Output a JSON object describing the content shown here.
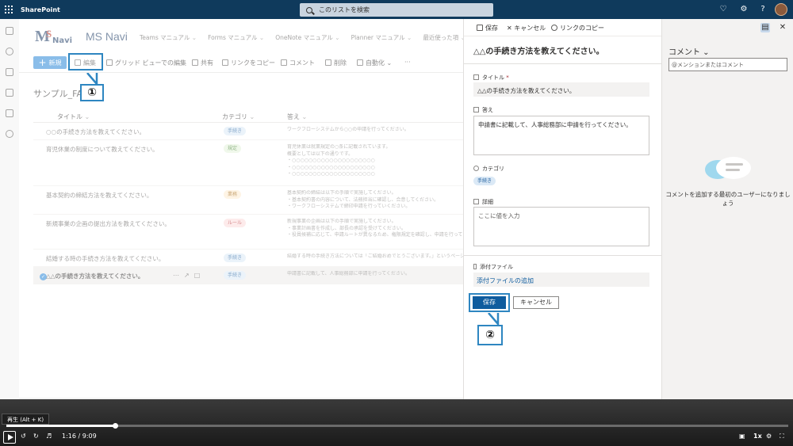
{
  "suitebar": {
    "brand": "SharePoint",
    "search_placeholder": "このリストを検索"
  },
  "site": {
    "logo_m": "M",
    "logo_s": "S",
    "logo_navi": "Navi",
    "title": "MS Navi",
    "nav": [
      "Teams マニュアル",
      "Forms マニュアル",
      "OneNote マニュアル",
      "Planner マニュアル",
      "最近使った項"
    ]
  },
  "commandbar": {
    "new": "新規",
    "edit": "編集",
    "grid_edit": "グリッド ビューでの編集",
    "share": "共有",
    "copy_link": "リンクをコピー",
    "comment": "コメント",
    "delete": "削除",
    "automate": "自動化",
    "more": "···"
  },
  "callouts": {
    "one": "①",
    "two": "②"
  },
  "list": {
    "title": "サンプル_FAQ",
    "columns": {
      "title": "タイトル",
      "category": "カテゴリ",
      "answer": "答え"
    },
    "rows": [
      {
        "title": "○○の手続き方法を教えてください。",
        "category": "手続き",
        "answer": "ワークフローシステムから○○の申請を行ってください。"
      },
      {
        "title": "育児休業の制度について教えてください。",
        "category": "規定",
        "answer": "育児休業は就業規定の○条に記載されています。\n概要としては以下の通りです。\n・○○○○○○○○○○○○○○○○○○○○\n・○○○○○○○○○○○○○○○○○○○○\n・○○○○○○○○○○○○○○○○○○○○"
      },
      {
        "title": "基本契約の締結方法を教えてください。",
        "category": "業務",
        "answer": "基本契約の締結は以下の手順で実施してください。\n・基本契約書の内容について、法務担当に確認し、合意してください。\n・ワークフローシステムで締印申請を行っていください。"
      },
      {
        "title": "新規事業の企画の提出方法を教えてください。",
        "category": "ルール",
        "answer": "新規事業の企画は以下の手順で実施してください。\n・事業計画書を作成し、部長の承認を受けてください。\n・役員候補に応じて、申請ルートが異なるため、権限規定を確認し、申請を行ってください。"
      },
      {
        "title": "結婚する時の手続き方法を教えてください。",
        "category": "手続き",
        "answer": "結婚する時の手続き方法については「ご結婚おめでとうございます。」というページを参照してください。"
      },
      {
        "title": "△△の手続き方法を教えてください。",
        "category": "手続き",
        "answer": "申請書に記載して、人事総務部に申請を行ってください。"
      }
    ],
    "pill_colors": {
      "手続き": "#dbe9f6",
      "規定": "#e3f3da",
      "業務": "#fdeccf",
      "ルール": "#fbdada"
    },
    "pill_text_colors": {
      "手続き": "#1f5f9e",
      "規定": "#3b7a2a",
      "業務": "#a0620c",
      "ルール": "#b3272d"
    }
  },
  "panel": {
    "toolbar": {
      "save": "保存",
      "cancel": "キャンセル",
      "copy_link": "リンクのコピー"
    },
    "title": "△△の手続き方法を教えてください。",
    "fields": {
      "title_label": "タイトル",
      "title_required": "*",
      "title_value": "△△の手続き方法を教えてください。",
      "answer_label": "答え",
      "answer_value": "申請書に記載して、人事総務部に申請を行ってください。",
      "category_label": "カテゴリ",
      "category_value": "手続き",
      "detail_label": "詳細",
      "detail_placeholder": "ここに値を入力",
      "attach_label": "添付ファイル",
      "attach_link": "添付ファイルの追加"
    },
    "save_button": "保存",
    "cancel_button": "キャンセル"
  },
  "comments": {
    "title": "コメント",
    "input_placeholder": "@メンションまたはコメント",
    "empty_text": "コメントを追加する最初のユーザーになりましょう"
  },
  "player": {
    "tooltip": "再生 (Alt + K)",
    "time": "1:16 / 9:09",
    "speed": "1x",
    "progress_fraction": 0.139
  },
  "colors": {
    "accent": "#2b88d8",
    "callout": "#2e86c1",
    "suitebar": "#0f3a5c",
    "save": "#0f5c9e"
  }
}
